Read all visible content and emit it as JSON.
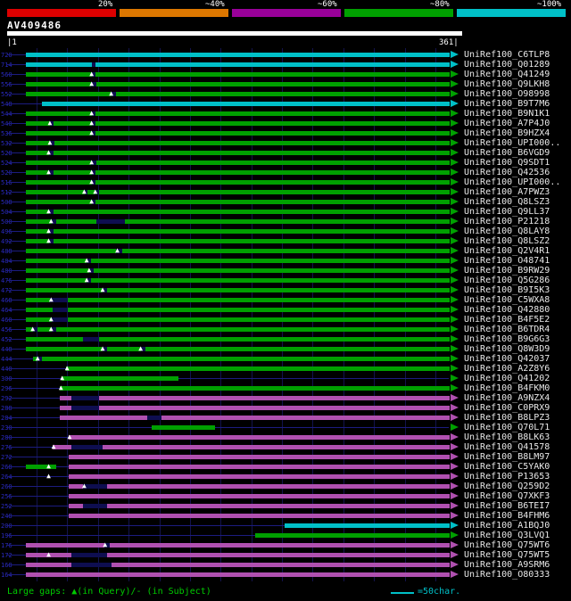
{
  "legend": {
    "items": [
      {
        "label": "20%",
        "color": "#dd0000"
      },
      {
        "label": "~40%",
        "color": "#dd7700"
      },
      {
        "label": "~60%",
        "color": "#990099"
      },
      {
        "label": "~80%",
        "color": "#00a000"
      },
      {
        "label": "~100%",
        "color": "#00c0c8"
      }
    ]
  },
  "header": {
    "accession": "AV409486"
  },
  "scale": {
    "start_label": "|1",
    "end_label": "361|",
    "length": 361
  },
  "palette": {
    "red": "#dd0000",
    "orange": "#dd7700",
    "purple": "#990099",
    "green": "#00a000",
    "cyan": "#00c0c8",
    "magenta": "#b050b0",
    "backbone": "#1c1c80",
    "dark": "#0e0e50",
    "grid": "#13134d",
    "text": "#e8e8e8",
    "score_text": "#2a2ac0"
  },
  "rows": [
    {
      "label": "UniRef100_C6TLP8",
      "score": "720",
      "color": "cyan",
      "segs": [
        {
          "s": 16,
          "e": 361
        }
      ]
    },
    {
      "label": "UniRef100_Q01289",
      "score": "714",
      "color": "cyan",
      "segs": [
        {
          "s": 16,
          "e": 361
        }
      ],
      "dark": [
        [
          70,
          72
        ]
      ]
    },
    {
      "label": "UniRef100_Q41249",
      "score": "560",
      "color": "green",
      "segs": [
        {
          "s": 16,
          "e": 361
        }
      ],
      "dark": [
        [
          70,
          72
        ]
      ],
      "tris": [
        71
      ]
    },
    {
      "label": "UniRef100_Q9LKH8",
      "score": "556",
      "color": "green",
      "segs": [
        {
          "s": 16,
          "e": 361
        }
      ],
      "dark": [
        [
          69,
          73
        ]
      ],
      "tris": [
        71
      ]
    },
    {
      "label": "UniRef100_O98998",
      "score": "552",
      "color": "green",
      "segs": [
        {
          "s": 16,
          "e": 361
        }
      ],
      "dark": [
        [
          86,
          89
        ]
      ],
      "tris": [
        87
      ]
    },
    {
      "label": "UniRef100_B9T7M6",
      "score": "548",
      "color": "cyan",
      "segs": [
        {
          "s": 29,
          "e": 361
        }
      ]
    },
    {
      "label": "UniRef100_B9N1K1",
      "score": "544",
      "color": "green",
      "segs": [
        {
          "s": 16,
          "e": 361
        }
      ],
      "dark": [
        [
          70,
          72
        ]
      ],
      "tris": [
        71
      ]
    },
    {
      "label": "UniRef100_A7P4J0",
      "score": "540",
      "color": "green",
      "segs": [
        {
          "s": 16,
          "e": 361
        }
      ],
      "dark": [
        [
          36,
          38
        ],
        [
          70,
          72
        ]
      ],
      "tris": [
        37,
        71
      ]
    },
    {
      "label": "UniRef100_B9HZX4",
      "score": "536",
      "color": "green",
      "segs": [
        {
          "s": 16,
          "e": 361
        }
      ],
      "dark": [
        [
          70,
          72
        ]
      ],
      "tris": [
        71
      ]
    },
    {
      "label": "UniRef100_UPI000..",
      "score": "532",
      "color": "green",
      "segs": [
        {
          "s": 16,
          "e": 361
        }
      ],
      "dark": [
        [
          36,
          39
        ]
      ],
      "tris": [
        37
      ]
    },
    {
      "label": "UniRef100_B6VGD9",
      "score": "528",
      "color": "green",
      "segs": [
        {
          "s": 16,
          "e": 361
        }
      ],
      "dark": [
        [
          35,
          38
        ]
      ],
      "tris": [
        36
      ]
    },
    {
      "label": "UniRef100_Q9SDT1",
      "score": "524",
      "color": "green",
      "segs": [
        {
          "s": 16,
          "e": 361
        }
      ],
      "dark": [
        [
          69,
          73
        ]
      ],
      "tris": [
        71
      ]
    },
    {
      "label": "UniRef100_Q42536",
      "score": "520",
      "color": "green",
      "segs": [
        {
          "s": 16,
          "e": 361
        }
      ],
      "dark": [
        [
          35,
          38
        ],
        [
          70,
          72
        ]
      ],
      "tris": [
        36,
        71
      ]
    },
    {
      "label": "UniRef100_UPI000..",
      "score": "516",
      "color": "green",
      "segs": [
        {
          "s": 16,
          "e": 361
        }
      ],
      "dark": [
        [
          70,
          72
        ]
      ],
      "tris": [
        71
      ]
    },
    {
      "label": "UniRef100_A7PWZ3",
      "score": "512",
      "color": "green",
      "segs": [
        {
          "s": 16,
          "e": 361
        }
      ],
      "dark": [
        [
          64,
          66
        ],
        [
          73,
          75
        ]
      ],
      "tris": [
        65,
        74
      ]
    },
    {
      "label": "UniRef100_Q8LSZ3",
      "score": "508",
      "color": "green",
      "segs": [
        {
          "s": 16,
          "e": 361
        }
      ],
      "dark": [
        [
          70,
          72
        ]
      ],
      "tris": [
        71
      ]
    },
    {
      "label": "UniRef100_Q9LL37",
      "score": "504",
      "color": "green",
      "segs": [
        {
          "s": 16,
          "e": 361
        }
      ],
      "dark": [
        [
          35,
          38
        ]
      ],
      "tris": [
        36
      ]
    },
    {
      "label": "UniRef100_P21218",
      "score": "500",
      "color": "green",
      "segs": [
        {
          "s": 16,
          "e": 361
        }
      ],
      "dark": [
        [
          37,
          40
        ],
        [
          74,
          96
        ]
      ],
      "tris": [
        38
      ]
    },
    {
      "label": "UniRef100_Q8LAY8",
      "score": "496",
      "color": "green",
      "segs": [
        {
          "s": 16,
          "e": 361
        }
      ],
      "dark": [
        [
          35,
          38
        ]
      ],
      "tris": [
        36
      ]
    },
    {
      "label": "UniRef100_Q8LSZ2",
      "score": "492",
      "color": "green",
      "segs": [
        {
          "s": 16,
          "e": 361
        }
      ],
      "dark": [
        [
          35,
          38
        ]
      ],
      "tris": [
        36
      ]
    },
    {
      "label": "UniRef100_Q2V4R1",
      "score": "488",
      "color": "green",
      "segs": [
        {
          "s": 16,
          "e": 361
        }
      ],
      "dark": [
        [
          90,
          94
        ]
      ],
      "tris": [
        92
      ]
    },
    {
      "label": "UniRef100_O48741",
      "score": "484",
      "color": "green",
      "segs": [
        {
          "s": 16,
          "e": 361
        }
      ],
      "dark": [
        [
          66,
          69
        ]
      ],
      "tris": [
        67
      ]
    },
    {
      "label": "UniRef100_B9RW29",
      "score": "480",
      "color": "green",
      "segs": [
        {
          "s": 16,
          "e": 361
        }
      ],
      "dark": [
        [
          68,
          71
        ]
      ],
      "tris": [
        69
      ]
    },
    {
      "label": "UniRef100_Q5G286",
      "score": "476",
      "color": "green",
      "segs": [
        {
          "s": 16,
          "e": 361
        }
      ],
      "dark": [
        [
          66,
          69
        ]
      ],
      "tris": [
        67
      ]
    },
    {
      "label": "UniRef100_B9I5K3",
      "score": "472",
      "color": "green",
      "segs": [
        {
          "s": 16,
          "e": 361
        }
      ],
      "dark": [
        [
          79,
          82
        ]
      ],
      "tris": [
        80
      ]
    },
    {
      "label": "UniRef100_C5WXA8",
      "score": "468",
      "color": "green",
      "segs": [
        {
          "s": 16,
          "e": 361
        }
      ],
      "dark": [
        [
          36,
          50
        ]
      ],
      "tris": [
        38
      ]
    },
    {
      "label": "UniRef100_Q42880",
      "score": "464",
      "color": "green",
      "segs": [
        {
          "s": 16,
          "e": 361
        }
      ],
      "dark": [
        [
          38,
          50
        ]
      ]
    },
    {
      "label": "UniRef100_B4F5E2",
      "score": "460",
      "color": "green",
      "segs": [
        {
          "s": 16,
          "e": 361
        }
      ],
      "dark": [
        [
          37,
          50
        ]
      ],
      "tris": [
        38
      ]
    },
    {
      "label": "UniRef100_B6TDR4",
      "score": "456",
      "color": "green",
      "segs": [
        {
          "s": 16,
          "e": 361
        }
      ],
      "dark": [
        [
          22,
          25
        ],
        [
          37,
          40
        ]
      ],
      "tris": [
        23,
        38
      ]
    },
    {
      "label": "UniRef100_B9G6G3",
      "score": "452",
      "color": "green",
      "segs": [
        {
          "s": 16,
          "e": 361
        }
      ],
      "dark": [
        [
          63,
          75
        ]
      ]
    },
    {
      "label": "UniRef100_Q8W3D9",
      "score": "448",
      "color": "green",
      "segs": [
        {
          "s": 16,
          "e": 361
        }
      ],
      "dark": [
        [
          79,
          82
        ],
        [
          110,
          113
        ]
      ],
      "tris": [
        80,
        111
      ]
    },
    {
      "label": "UniRef100_Q42037",
      "score": "444",
      "color": "green",
      "segs": [
        {
          "s": 22,
          "e": 361
        }
      ],
      "dark": [
        [
          26,
          29
        ]
      ],
      "tris": [
        27
      ]
    },
    {
      "label": "UniRef100_A2Z8Y6",
      "score": "440",
      "color": "green",
      "segs": [
        {
          "s": 49,
          "e": 361
        }
      ],
      "tris": [
        51
      ]
    },
    {
      "label": "UniRef100_Q41202",
      "score": "300",
      "color": "green",
      "segs": [
        {
          "s": 45,
          "e": 140
        }
      ],
      "tris": [
        47
      ]
    },
    {
      "label": "UniRef100_B4FKM0",
      "score": "296",
      "color": "green",
      "segs": [
        {
          "s": 44,
          "e": 361
        }
      ],
      "tris": [
        46
      ]
    },
    {
      "label": "UniRef100_A9NZX4",
      "score": "292",
      "color": "magenta",
      "segs": [
        {
          "s": 44,
          "e": 361
        }
      ],
      "dark": [
        [
          53,
          75
        ]
      ]
    },
    {
      "label": "UniRef100_C0PRX9",
      "score": "288",
      "color": "magenta",
      "segs": [
        {
          "s": 44,
          "e": 361
        }
      ],
      "dark": [
        [
          53,
          75
        ]
      ]
    },
    {
      "label": "UniRef100_B8LPZ3",
      "score": "284",
      "color": "magenta",
      "segs": [
        {
          "s": 44,
          "e": 361
        }
      ],
      "dark": [
        [
          115,
          126
        ]
      ]
    },
    {
      "label": "UniRef100_Q70L71",
      "score": "230",
      "color": "green",
      "segs": [
        {
          "s": 119,
          "e": 170
        }
      ]
    },
    {
      "label": "UniRef100_B8LK63",
      "score": "280",
      "color": "magenta",
      "segs": [
        {
          "s": 51,
          "e": 361
        }
      ],
      "tris": [
        53
      ]
    },
    {
      "label": "UniRef100_Q41578",
      "score": "276",
      "color": "magenta",
      "segs": [
        {
          "s": 38,
          "e": 361
        }
      ],
      "dark": [
        [
          53,
          78
        ]
      ],
      "tris": [
        40
      ]
    },
    {
      "label": "UniRef100_B8LM97",
      "score": "272",
      "color": "magenta",
      "segs": [
        {
          "s": 51,
          "e": 361
        }
      ]
    },
    {
      "label": "UniRef100_C5YAK0",
      "score": "268",
      "color": "magenta",
      "segs": [
        {
          "s": 16,
          "e": 40,
          "c": "green"
        },
        {
          "s": 51,
          "e": 361
        }
      ],
      "tris": [
        36
      ]
    },
    {
      "label": "UniRef100_P13653",
      "score": "264",
      "color": "magenta",
      "segs": [
        {
          "s": 51,
          "e": 361
        }
      ],
      "tris": [
        36
      ]
    },
    {
      "label": "UniRef100_Q259D2",
      "score": "260",
      "color": "magenta",
      "segs": [
        {
          "s": 51,
          "e": 361
        }
      ],
      "dark": [
        [
          63,
          82
        ]
      ],
      "tris": [
        65
      ]
    },
    {
      "label": "UniRef100_Q7XKF3",
      "score": "256",
      "color": "magenta",
      "segs": [
        {
          "s": 51,
          "e": 361
        }
      ]
    },
    {
      "label": "UniRef100_B6TEI7",
      "score": "252",
      "color": "magenta",
      "segs": [
        {
          "s": 51,
          "e": 361
        }
      ],
      "dark": [
        [
          63,
          82
        ]
      ]
    },
    {
      "label": "UniRef100_B4FHM6",
      "score": "248",
      "color": "magenta",
      "segs": [
        {
          "s": 51,
          "e": 361
        }
      ]
    },
    {
      "label": "UniRef100_A1BQJ0",
      "score": "200",
      "color": "cyan",
      "segs": [
        {
          "s": 227,
          "e": 361
        }
      ]
    },
    {
      "label": "UniRef100_Q3LVQ1",
      "score": "196",
      "color": "green",
      "segs": [
        {
          "s": 203,
          "e": 361
        }
      ]
    },
    {
      "label": "UniRef100_Q75WT6",
      "score": "176",
      "color": "magenta",
      "segs": [
        {
          "s": 16,
          "e": 361
        }
      ],
      "dark": [
        [
          80,
          84
        ]
      ],
      "tris": [
        82
      ]
    },
    {
      "label": "UniRef100_Q75WT5",
      "score": "172",
      "color": "magenta",
      "segs": [
        {
          "s": 16,
          "e": 361
        }
      ],
      "dark": [
        [
          53,
          82
        ]
      ],
      "tris": [
        36
      ]
    },
    {
      "label": "UniRef100_A9SRM6",
      "score": "168",
      "color": "magenta",
      "segs": [
        {
          "s": 16,
          "e": 361
        }
      ],
      "dark": [
        [
          53,
          85
        ]
      ]
    },
    {
      "label": "UniRef100_O80333",
      "score": "164",
      "color": "magenta",
      "segs": [
        {
          "s": 16,
          "e": 361
        }
      ]
    }
  ],
  "footer": {
    "gaps_label": "Large gaps: ▲(in Query)/- (in Subject)",
    "scale_label": "=50char."
  }
}
